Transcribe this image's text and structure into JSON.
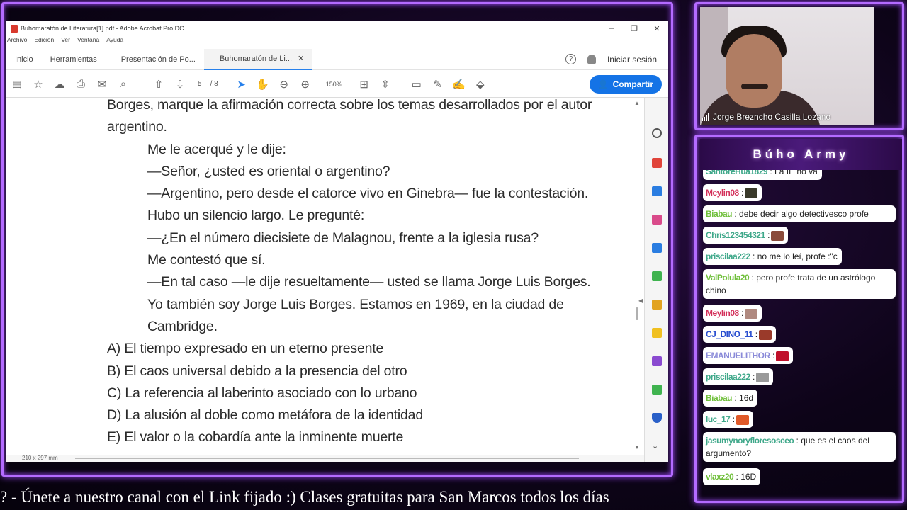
{
  "acrobat": {
    "window_title": "Buhomaratón de Literatura[1].pdf - Adobe Acrobat Pro DC",
    "menu": [
      "Archivo",
      "Edición",
      "Ver",
      "Ventana",
      "Ayuda"
    ],
    "tabs": [
      "Inicio",
      "Herramientas",
      "Presentación de Po...",
      "Buhomaratón de Li..."
    ],
    "sign_in": "Iniciar sesión",
    "page_current": "5",
    "page_total": "/ 8",
    "zoom": "150%",
    "share_label": "Compartir",
    "page_size": "210 x 297 mm"
  },
  "document": {
    "lines": [
      "Borges, marque la afirmación correcta sobre los temas desarrollados por el autor",
      "argentino.",
      "Me le acerqué y le dije:",
      "—Señor, ¿usted es oriental o argentino?",
      "—Argentino, pero desde el catorce vivo en Ginebra— fue la contestación.",
      "Hubo un silencio largo. Le pregunté:",
      "—¿En el número diecisiete de Malagnou, frente a la iglesia rusa?",
      "Me contestó que sí.",
      "—En tal caso —le dije resueltamente— usted se llama Jorge Luis Borges.",
      "Yo también soy Jorge Luis Borges. Estamos en 1969, en la ciudad de",
      "Cambridge.",
      "A) El tiempo expresado en un eterno presente",
      "B) El caos universal debido a la presencia del otro",
      "C) La referencia al laberinto asociado con lo urbano",
      "D) La alusión al doble como metáfora de la identidad",
      "E) El valor o la cobardía ante la inminente muerte"
    ]
  },
  "webcam": {
    "name": "Jorge Breznchо Casilla Lozano"
  },
  "chat": {
    "title": "Búho Army",
    "messages": [
      {
        "user": "SantoreHua1829",
        "text": ": La IE no va",
        "color": "#3fa88a"
      },
      {
        "user": "Meylin08",
        "text": ":",
        "color": "#d3305a",
        "emote": "#3a3a2a"
      },
      {
        "user": "Biabau",
        "text": ": debe decir algo detectivesco profe",
        "color": "#6fbf3a"
      },
      {
        "user": "Chris123454321",
        "text": ":",
        "color": "#3fa88a",
        "emote": "#8a4a3a"
      },
      {
        "user": "priscilaa222",
        "text": ": no me lo leí, profe :\"c",
        "color": "#3fa88a"
      },
      {
        "user": "ValPolula20",
        "text": ": pero profe trata de un astrólogo chino",
        "color": "#6fbf3a"
      },
      {
        "user": "Meylin08",
        "text": ":",
        "color": "#d3305a",
        "emote": "#b08a80"
      },
      {
        "user": "CJ_DINO_11",
        "text": ":",
        "color": "#2a4fd0",
        "emote": "#9a3a2a"
      },
      {
        "user": "EMANUELITHOR",
        "text": ":",
        "color": "#8a8ad8",
        "emote": "#c0102a"
      },
      {
        "user": "priscilaa222",
        "text": ":",
        "color": "#3fa88a",
        "emote": "#9a9a9a"
      },
      {
        "user": "Biabau",
        "text": ": 16d",
        "color": "#6fbf3a"
      },
      {
        "user": "luc_17",
        "text": ":",
        "color": "#3fa88a",
        "emote": "#e05a2a"
      },
      {
        "user": "jasumynoryfloresosceo",
        "text": ": que es el caos del argumento?",
        "color": "#3fa88a"
      },
      {
        "user": "vlaxz20",
        "text": ": 16D",
        "color": "#6fbf3a"
      }
    ]
  },
  "ticker": {
    "text": "?   -   Únete a nuestro canal con el Link fijado :)  Clases gratuitas para San Marcos todos los días"
  }
}
